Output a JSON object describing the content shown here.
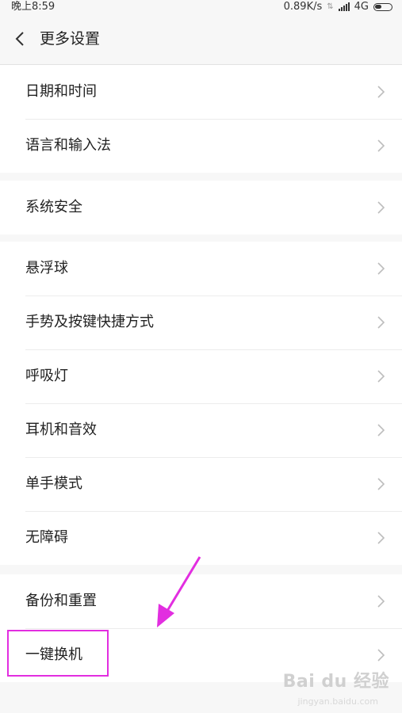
{
  "status_bar": {
    "time": "晚上8:59",
    "speed": "0.89K/s",
    "network": "4G"
  },
  "header": {
    "title": "更多设置"
  },
  "groups": [
    {
      "items": [
        {
          "label": "日期和时间"
        },
        {
          "label": "语言和输入法"
        }
      ]
    },
    {
      "items": [
        {
          "label": "系统安全"
        }
      ]
    },
    {
      "items": [
        {
          "label": "悬浮球"
        },
        {
          "label": "手势及按键快捷方式"
        },
        {
          "label": "呼吸灯"
        },
        {
          "label": "耳机和音效"
        },
        {
          "label": "单手模式"
        },
        {
          "label": "无障碍"
        }
      ]
    },
    {
      "items": [
        {
          "label": "备份和重置"
        },
        {
          "label": "一键换机"
        }
      ]
    }
  ],
  "annotation": {
    "color": "#e22ee0"
  },
  "watermark": {
    "text": "Bai du 经验",
    "sub": "jingyan.baidu.com"
  }
}
